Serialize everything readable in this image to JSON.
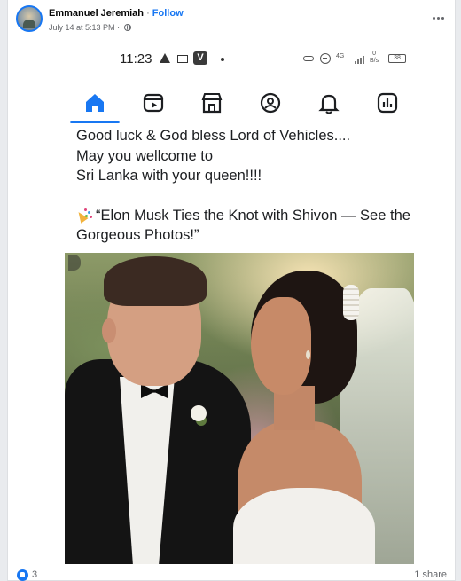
{
  "post": {
    "author": "Emmanuel Jeremiah",
    "separator": "·",
    "follow_label": "Follow",
    "timestamp": "July 14 at 5:13 PM",
    "meta_separator": "·",
    "privacy_icon": "globe-icon",
    "more_icon": "more-options-icon"
  },
  "phone": {
    "time": "11:23",
    "status_icons": [
      "warning-icon",
      "message-icon",
      "v-app-icon",
      "dot-icon",
      "key-icon",
      "do-not-disturb-icon",
      "signal-4g-icon",
      "signal-bars-icon",
      "battery-icon"
    ],
    "net_speed_value": "0",
    "net_speed_unit": "B/s",
    "network_label": "4G",
    "battery_level": "38",
    "tabs": [
      {
        "icon": "home-icon",
        "active": true
      },
      {
        "icon": "video-icon",
        "active": false
      },
      {
        "icon": "marketplace-icon",
        "active": false
      },
      {
        "icon": "groups-icon",
        "active": false
      },
      {
        "icon": "bell-icon",
        "active": false
      },
      {
        "icon": "dashboard-icon",
        "active": false
      }
    ],
    "accent_color": "#1877f2"
  },
  "content": {
    "line1": "Good luck & God bless Lord of Vehicles....",
    "line2": "May you wellcome to",
    "line3": "Sri Lanka with your queen!!!!",
    "headline": "“Elon Musk Ties the Knot with Shivon — See the Gorgeous Photos!”",
    "headline_icon": "party-popper-icon"
  },
  "footer": {
    "reaction_icon": "like-reaction-icon",
    "reaction_count": "3",
    "shares": "1 share"
  }
}
